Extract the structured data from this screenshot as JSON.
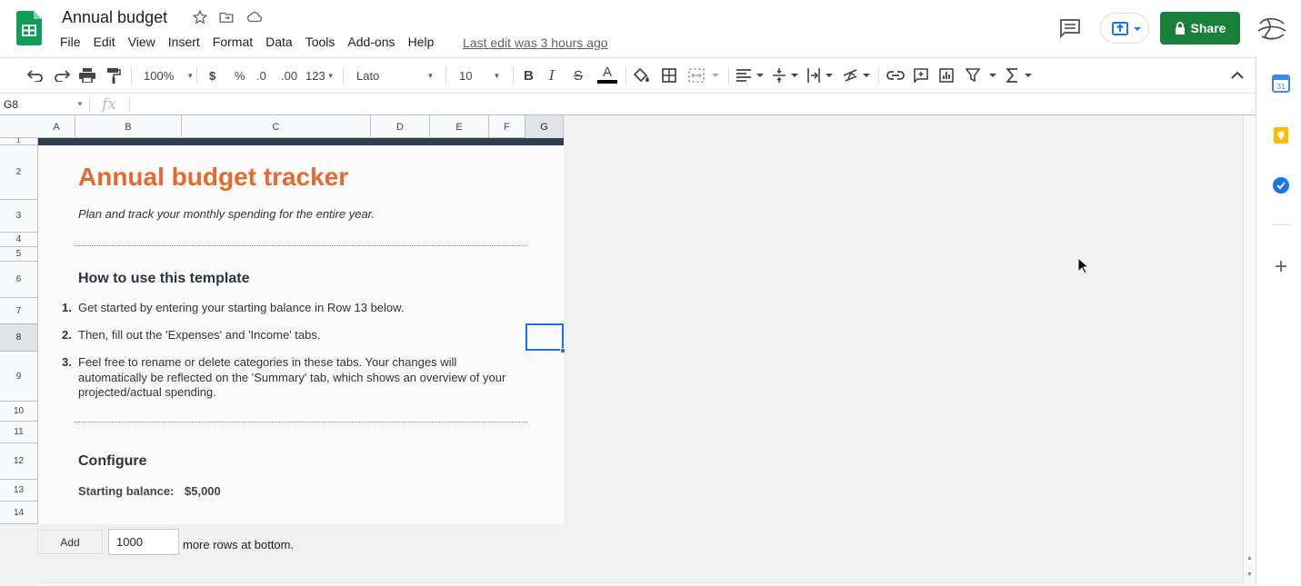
{
  "header": {
    "title": "Annual budget",
    "menu": [
      "File",
      "Edit",
      "View",
      "Insert",
      "Format",
      "Data",
      "Tools",
      "Add-ons",
      "Help"
    ],
    "last_edit": "Last edit was 3 hours ago",
    "share_label": "Share"
  },
  "toolbar": {
    "zoom": "100%",
    "currency": "$",
    "percent": "%",
    "dec_decrease": ".0",
    "dec_increase": ".00",
    "format_more": "123",
    "font": "Lato",
    "font_size": "10",
    "bold": "B",
    "italic": "I",
    "strike": "S",
    "text_color": "A"
  },
  "formula_bar": {
    "cell_ref": "G8",
    "fx": "fx"
  },
  "columns": [
    "A",
    "B",
    "C",
    "D",
    "E",
    "F",
    "G"
  ],
  "selected_column": "G",
  "rows": [
    "1",
    "2",
    "3",
    "4",
    "5",
    "6",
    "7",
    "8",
    "9",
    "10",
    "11",
    "12",
    "13",
    "14"
  ],
  "selected_row": "8",
  "sheet": {
    "title": "Annual budget tracker",
    "subtitle": "Plan and track your monthly spending for the entire year.",
    "how_to_heading": "How to use this template",
    "steps": [
      {
        "num": "1.",
        "text": "Get started by entering your starting balance in Row 13 below."
      },
      {
        "num": "2.",
        "text": "Then, fill out the 'Expenses' and 'Income' tabs."
      },
      {
        "num": "3.",
        "text": "Feel free to rename or delete categories in these tabs. Your changes will automatically be reflected on the 'Summary' tab, which shows an overview of your projected/actual spending."
      }
    ],
    "configure_heading": "Configure",
    "starting_balance_label": "Starting balance:",
    "starting_balance_value": "$5,000"
  },
  "add_rows": {
    "button": "Add",
    "count": "1000",
    "suffix": "more rows at bottom."
  },
  "colors": {
    "accent_orange": "#e8692e",
    "header_band": "#2e3d4f",
    "share_green": "#188038",
    "selection_blue": "#1a73e8"
  }
}
